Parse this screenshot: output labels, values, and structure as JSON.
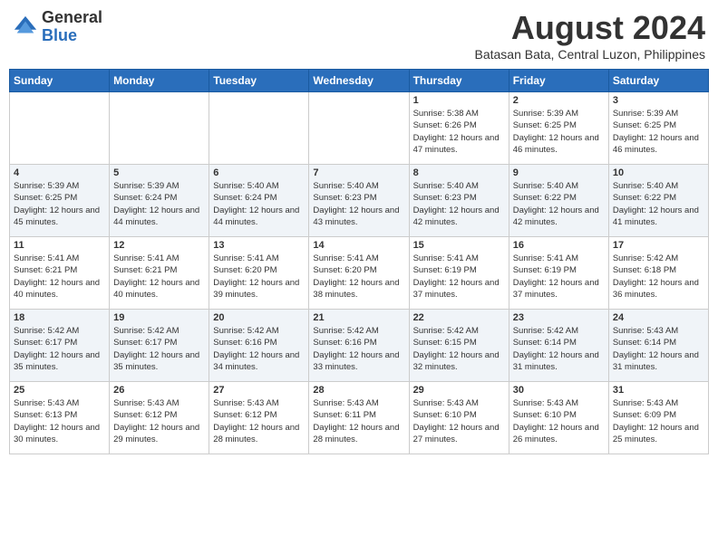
{
  "header": {
    "logo_general": "General",
    "logo_blue": "Blue",
    "month_year": "August 2024",
    "location": "Batasan Bata, Central Luzon, Philippines"
  },
  "weekdays": [
    "Sunday",
    "Monday",
    "Tuesday",
    "Wednesday",
    "Thursday",
    "Friday",
    "Saturday"
  ],
  "weeks": [
    [
      {
        "day": "",
        "sunrise": "",
        "sunset": "",
        "daylight": ""
      },
      {
        "day": "",
        "sunrise": "",
        "sunset": "",
        "daylight": ""
      },
      {
        "day": "",
        "sunrise": "",
        "sunset": "",
        "daylight": ""
      },
      {
        "day": "",
        "sunrise": "",
        "sunset": "",
        "daylight": ""
      },
      {
        "day": "1",
        "sunrise": "Sunrise: 5:38 AM",
        "sunset": "Sunset: 6:26 PM",
        "daylight": "Daylight: 12 hours and 47 minutes."
      },
      {
        "day": "2",
        "sunrise": "Sunrise: 5:39 AM",
        "sunset": "Sunset: 6:25 PM",
        "daylight": "Daylight: 12 hours and 46 minutes."
      },
      {
        "day": "3",
        "sunrise": "Sunrise: 5:39 AM",
        "sunset": "Sunset: 6:25 PM",
        "daylight": "Daylight: 12 hours and 46 minutes."
      }
    ],
    [
      {
        "day": "4",
        "sunrise": "Sunrise: 5:39 AM",
        "sunset": "Sunset: 6:25 PM",
        "daylight": "Daylight: 12 hours and 45 minutes."
      },
      {
        "day": "5",
        "sunrise": "Sunrise: 5:39 AM",
        "sunset": "Sunset: 6:24 PM",
        "daylight": "Daylight: 12 hours and 44 minutes."
      },
      {
        "day": "6",
        "sunrise": "Sunrise: 5:40 AM",
        "sunset": "Sunset: 6:24 PM",
        "daylight": "Daylight: 12 hours and 44 minutes."
      },
      {
        "day": "7",
        "sunrise": "Sunrise: 5:40 AM",
        "sunset": "Sunset: 6:23 PM",
        "daylight": "Daylight: 12 hours and 43 minutes."
      },
      {
        "day": "8",
        "sunrise": "Sunrise: 5:40 AM",
        "sunset": "Sunset: 6:23 PM",
        "daylight": "Daylight: 12 hours and 42 minutes."
      },
      {
        "day": "9",
        "sunrise": "Sunrise: 5:40 AM",
        "sunset": "Sunset: 6:22 PM",
        "daylight": "Daylight: 12 hours and 42 minutes."
      },
      {
        "day": "10",
        "sunrise": "Sunrise: 5:40 AM",
        "sunset": "Sunset: 6:22 PM",
        "daylight": "Daylight: 12 hours and 41 minutes."
      }
    ],
    [
      {
        "day": "11",
        "sunrise": "Sunrise: 5:41 AM",
        "sunset": "Sunset: 6:21 PM",
        "daylight": "Daylight: 12 hours and 40 minutes."
      },
      {
        "day": "12",
        "sunrise": "Sunrise: 5:41 AM",
        "sunset": "Sunset: 6:21 PM",
        "daylight": "Daylight: 12 hours and 40 minutes."
      },
      {
        "day": "13",
        "sunrise": "Sunrise: 5:41 AM",
        "sunset": "Sunset: 6:20 PM",
        "daylight": "Daylight: 12 hours and 39 minutes."
      },
      {
        "day": "14",
        "sunrise": "Sunrise: 5:41 AM",
        "sunset": "Sunset: 6:20 PM",
        "daylight": "Daylight: 12 hours and 38 minutes."
      },
      {
        "day": "15",
        "sunrise": "Sunrise: 5:41 AM",
        "sunset": "Sunset: 6:19 PM",
        "daylight": "Daylight: 12 hours and 37 minutes."
      },
      {
        "day": "16",
        "sunrise": "Sunrise: 5:41 AM",
        "sunset": "Sunset: 6:19 PM",
        "daylight": "Daylight: 12 hours and 37 minutes."
      },
      {
        "day": "17",
        "sunrise": "Sunrise: 5:42 AM",
        "sunset": "Sunset: 6:18 PM",
        "daylight": "Daylight: 12 hours and 36 minutes."
      }
    ],
    [
      {
        "day": "18",
        "sunrise": "Sunrise: 5:42 AM",
        "sunset": "Sunset: 6:17 PM",
        "daylight": "Daylight: 12 hours and 35 minutes."
      },
      {
        "day": "19",
        "sunrise": "Sunrise: 5:42 AM",
        "sunset": "Sunset: 6:17 PM",
        "daylight": "Daylight: 12 hours and 35 minutes."
      },
      {
        "day": "20",
        "sunrise": "Sunrise: 5:42 AM",
        "sunset": "Sunset: 6:16 PM",
        "daylight": "Daylight: 12 hours and 34 minutes."
      },
      {
        "day": "21",
        "sunrise": "Sunrise: 5:42 AM",
        "sunset": "Sunset: 6:16 PM",
        "daylight": "Daylight: 12 hours and 33 minutes."
      },
      {
        "day": "22",
        "sunrise": "Sunrise: 5:42 AM",
        "sunset": "Sunset: 6:15 PM",
        "daylight": "Daylight: 12 hours and 32 minutes."
      },
      {
        "day": "23",
        "sunrise": "Sunrise: 5:42 AM",
        "sunset": "Sunset: 6:14 PM",
        "daylight": "Daylight: 12 hours and 31 minutes."
      },
      {
        "day": "24",
        "sunrise": "Sunrise: 5:43 AM",
        "sunset": "Sunset: 6:14 PM",
        "daylight": "Daylight: 12 hours and 31 minutes."
      }
    ],
    [
      {
        "day": "25",
        "sunrise": "Sunrise: 5:43 AM",
        "sunset": "Sunset: 6:13 PM",
        "daylight": "Daylight: 12 hours and 30 minutes."
      },
      {
        "day": "26",
        "sunrise": "Sunrise: 5:43 AM",
        "sunset": "Sunset: 6:12 PM",
        "daylight": "Daylight: 12 hours and 29 minutes."
      },
      {
        "day": "27",
        "sunrise": "Sunrise: 5:43 AM",
        "sunset": "Sunset: 6:12 PM",
        "daylight": "Daylight: 12 hours and 28 minutes."
      },
      {
        "day": "28",
        "sunrise": "Sunrise: 5:43 AM",
        "sunset": "Sunset: 6:11 PM",
        "daylight": "Daylight: 12 hours and 28 minutes."
      },
      {
        "day": "29",
        "sunrise": "Sunrise: 5:43 AM",
        "sunset": "Sunset: 6:10 PM",
        "daylight": "Daylight: 12 hours and 27 minutes."
      },
      {
        "day": "30",
        "sunrise": "Sunrise: 5:43 AM",
        "sunset": "Sunset: 6:10 PM",
        "daylight": "Daylight: 12 hours and 26 minutes."
      },
      {
        "day": "31",
        "sunrise": "Sunrise: 5:43 AM",
        "sunset": "Sunset: 6:09 PM",
        "daylight": "Daylight: 12 hours and 25 minutes."
      }
    ]
  ]
}
